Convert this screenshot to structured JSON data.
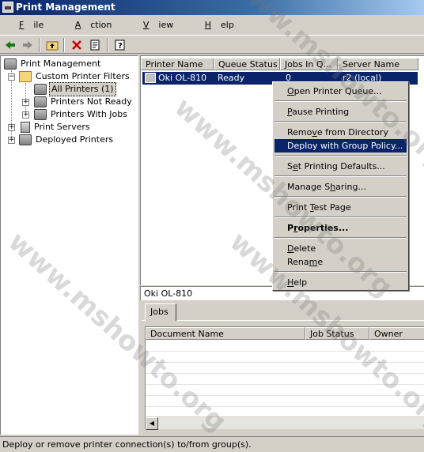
{
  "window": {
    "title": "Print Management"
  },
  "menubar": [
    {
      "pre": "",
      "key": "F",
      "post": "ile"
    },
    {
      "pre": "",
      "key": "A",
      "post": "ction"
    },
    {
      "pre": "",
      "key": "V",
      "post": "iew"
    },
    {
      "pre": "",
      "key": "H",
      "post": "elp"
    }
  ],
  "toolbar": {
    "icons": [
      "back-arrow-icon",
      "forward-arrow-icon",
      "up-folder-icon",
      "delete-icon",
      "properties-icon",
      "help-icon"
    ],
    "colors": {
      "back": "#1a7a1a",
      "delete": "#d00000"
    }
  },
  "tree": {
    "root": "Print Management",
    "custom_filters": "Custom Printer Filters",
    "all_printers": "All Printers (1)",
    "not_ready": "Printers Not Ready",
    "with_jobs": "Printers With Jobs",
    "print_servers": "Print Servers",
    "deployed": "Deployed Printers"
  },
  "list": {
    "columns": [
      "Printer Name",
      "Queue Status",
      "Jobs In Q...",
      "Server Name"
    ],
    "rows": [
      {
        "name": "Oki OL-810",
        "status": "Ready",
        "jobs": "0",
        "server": "r2 (local)"
      }
    ]
  },
  "context_menu": [
    {
      "pre": "",
      "key": "O",
      "post": "pen Printer Queue...",
      "bold": false
    },
    {
      "sep": true
    },
    {
      "pre": "",
      "key": "P",
      "post": "ause Printing",
      "bold": false
    },
    {
      "sep": true
    },
    {
      "pre": "Remo",
      "key": "v",
      "post": "e from Directory",
      "bold": false
    },
    {
      "pre": "Deploy with Group Policy...",
      "key": "",
      "post": "",
      "bold": false,
      "highlighted": true
    },
    {
      "sep": true
    },
    {
      "pre": "S",
      "key": "e",
      "post": "t Printing Defaults...",
      "bold": false
    },
    {
      "sep": true
    },
    {
      "pre": "Manage S",
      "key": "h",
      "post": "aring...",
      "bold": false
    },
    {
      "sep": true
    },
    {
      "pre": "Print ",
      "key": "T",
      "post": "est Page",
      "bold": false
    },
    {
      "sep": true
    },
    {
      "pre": "P",
      "key": "r",
      "post": "operties...",
      "bold": true
    },
    {
      "sep": true
    },
    {
      "pre": "",
      "key": "D",
      "post": "elete",
      "bold": false
    },
    {
      "pre": "Rena",
      "key": "m",
      "post": "e",
      "bold": false
    },
    {
      "sep": true
    },
    {
      "pre": "",
      "key": "H",
      "post": "elp",
      "bold": false
    }
  ],
  "detail": {
    "title": "Oki OL-810",
    "tab": "Jobs",
    "columns": [
      "Document Name",
      "Job Status",
      "Owner"
    ]
  },
  "status": "Deploy or remove printer connection(s) to/from group(s).",
  "watermark": "www.mshowto.org"
}
